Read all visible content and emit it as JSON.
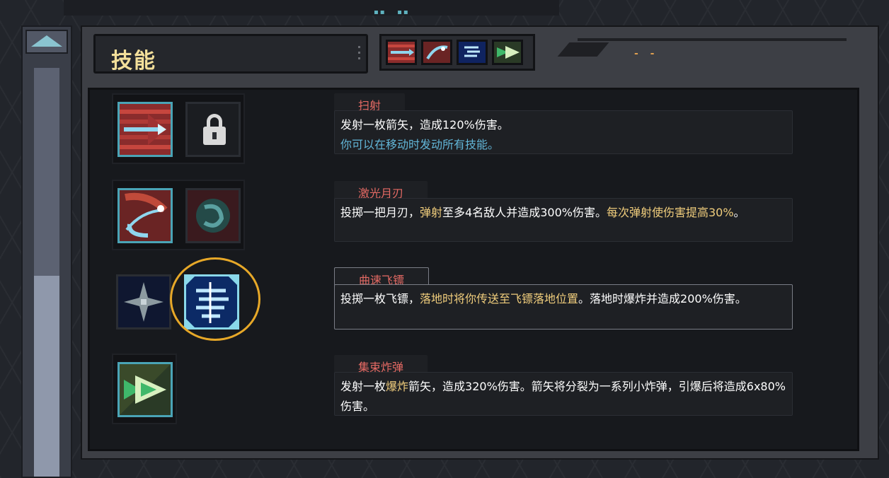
{
  "header": {
    "title": "技能",
    "tabs": [
      {
        "icon": "arrow-volley-icon",
        "color": "#b83a3a"
      },
      {
        "icon": "crescent-blade-icon",
        "color": "#3a6cc0"
      },
      {
        "icon": "spiral-shuriken-icon",
        "color": "#1b3a8a"
      },
      {
        "icon": "cluster-bomb-icon",
        "color": "#2c8a3c"
      }
    ]
  },
  "skills": [
    {
      "name": "扫射",
      "desc": "发射一枚箭矢，造成120%伤害。",
      "note": "你可以在移动时发动所有技能。",
      "icons": [
        "arrow-volley-icon",
        "lock-icon"
      ],
      "locked": true
    },
    {
      "name": "激光月刃",
      "desc_prefix": "投掷一把月刃，",
      "desc_hl": "弹射",
      "desc_rest": "至多4名敌人并造成300%伤害。",
      "desc_hl2": "每次弹射使伤害提高30%",
      "desc_end": "。",
      "icons": [
        "crescent-blade-icon",
        "vortex-icon"
      ]
    },
    {
      "name": "曲速飞镖",
      "desc_prefix": "投掷一枚飞镖，",
      "desc_hl": "落地时将你传送至飞镖落地位置",
      "desc_rest": "。落地时爆炸并造成200%伤害。",
      "icons": [
        "starburst-icon",
        "spiral-shuriken-icon"
      ],
      "selected_icon": "spiral-shuriken-icon"
    },
    {
      "name": "集束炸弹",
      "desc_prefix": "发射一枚",
      "desc_hl": "爆炸",
      "desc_rest": "箭矢，造成320%伤害。箭矢将分裂为一系列小炸弹，引爆后将造成6x80%伤害。",
      "icons": [
        "cluster-bomb-icon"
      ]
    }
  ],
  "colors": {
    "accent_border": "#4aa4b6",
    "selection_ring": "#e7a828",
    "title_gold": "#f3df9a",
    "skill_name_red": "#e56a64",
    "highlight_gold": "#f0cd7c",
    "note_blue": "#62b6d8"
  }
}
